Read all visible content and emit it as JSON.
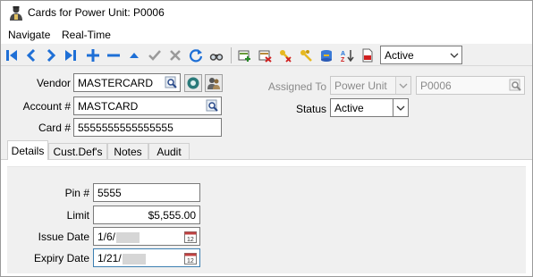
{
  "window": {
    "title": "Cards for Power Unit: P0006"
  },
  "menu": {
    "items": [
      "Navigate",
      "Real-Time"
    ]
  },
  "toolbar": {
    "buttons": [
      "first",
      "previous",
      "next",
      "last",
      "add",
      "delete",
      "up",
      "post",
      "cancel",
      "refresh",
      "search",
      "new-card",
      "remove-card",
      "key",
      "keys",
      "database",
      "sort",
      "export"
    ],
    "filter_value": "Active"
  },
  "form": {
    "vendor": {
      "label": "Vendor",
      "value": "MASTERCARD"
    },
    "account": {
      "label": "Account #",
      "value": "MASTCARD"
    },
    "card": {
      "label": "Card #",
      "value": "5555555555555555"
    },
    "assigned_to": {
      "label": "Assigned To",
      "type_value": "Power Unit",
      "unit_value": "P0006"
    },
    "status": {
      "label": "Status",
      "value": "Active"
    }
  },
  "tabs": [
    "Details",
    "Cust.Def's",
    "Notes",
    "Audit"
  ],
  "details": {
    "pin": {
      "label": "Pin #",
      "value": "5555"
    },
    "limit": {
      "label": "Limit",
      "value": "$5,555.00"
    },
    "issue_date": {
      "label": "Issue Date",
      "value": "1/6/"
    },
    "expiry_date": {
      "label": "Expiry Date",
      "value": "1/21/"
    }
  },
  "colors": {
    "accent_blue": "#1e6fd6",
    "focus_border": "#3c7fb1"
  }
}
